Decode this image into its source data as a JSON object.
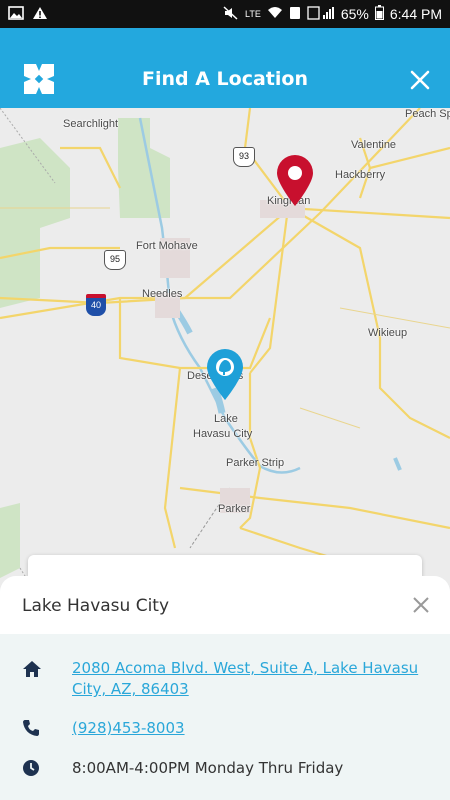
{
  "status_bar": {
    "battery": "65%",
    "time": "6:44 PM",
    "network": "LTE"
  },
  "header": {
    "title": "Find A Location",
    "brand_color": "#23a8de"
  },
  "map": {
    "places": {
      "searchlight": "Searchlight",
      "valentine": "Valentine",
      "hackberry": "Hackberry",
      "kingman": "Kingman",
      "fort_mohave": "Fort Mohave",
      "needles": "Needles",
      "wikieup": "Wikieup",
      "desert_hills": "Desert Hills",
      "lake_havasu_1": "Lake",
      "lake_havasu_2": "Havasu City",
      "parker_strip": "Parker Strip",
      "parker": "Parker",
      "peach_springs": "Peach Sp"
    },
    "shields": {
      "us93": "93",
      "us95": "95",
      "i40": "40"
    },
    "pins": [
      {
        "name": "kingman-pin",
        "color": "#c8102e"
      },
      {
        "name": "lake-havasu-pin",
        "color": "#1ea0d8",
        "selected": true
      }
    ]
  },
  "location": {
    "title": "Lake Havasu City",
    "address_line1": "2080 Acoma Blvd. West, Suite A, Lake Havasu",
    "address_line2": "City, AZ, 86403",
    "phone": "(928)453-8003",
    "hours": "8:00AM-4:00PM Monday Thru Friday"
  }
}
